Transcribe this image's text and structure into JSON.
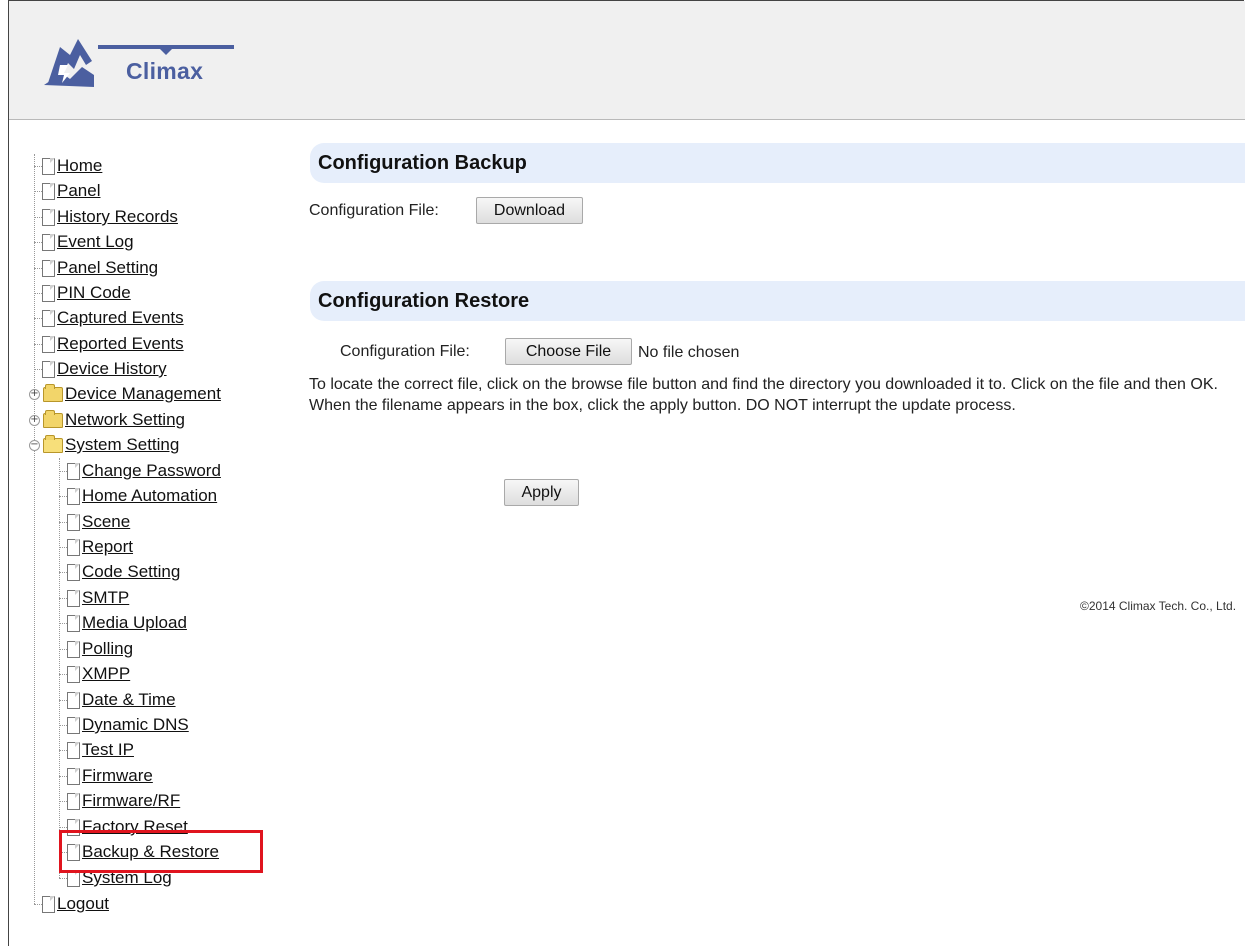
{
  "brand": {
    "name": "Climax"
  },
  "nav": {
    "home": "Home",
    "panel": "Panel",
    "history_records": "History Records",
    "event_log": "Event Log",
    "panel_setting": "Panel Setting",
    "pin_code": "PIN Code",
    "captured_events": "Captured Events",
    "reported_events": "Reported Events",
    "device_history": "Device History",
    "device_management": "Device Management",
    "network_setting": "Network Setting",
    "system_setting": "System Setting",
    "system_children": {
      "change_password": "Change Password",
      "home_automation": "Home Automation",
      "scene": "Scene",
      "report": "Report",
      "code_setting": "Code Setting",
      "smtp": "SMTP",
      "media_upload": "Media Upload",
      "polling": "Polling",
      "xmpp": "XMPP",
      "date_time": "Date & Time",
      "dynamic_dns": "Dynamic DNS",
      "test_ip": "Test IP",
      "firmware": "Firmware",
      "firmware_rf": "Firmware/RF",
      "factory_reset": "Factory Reset",
      "backup_restore": "Backup & Restore",
      "system_log": "System Log"
    },
    "logout": "Logout",
    "expanded_symbol": "−",
    "collapsed_symbol": "+"
  },
  "backup": {
    "title": "Configuration Backup",
    "file_label": "Configuration File:",
    "download_button": "Download"
  },
  "restore": {
    "title": "Configuration Restore",
    "file_label": "Configuration File:",
    "choose_button": "Choose File",
    "no_file": "No file chosen",
    "instructions": "To locate the correct file, click on the browse file button and find the directory you downloaded it to. Click on the file and then OK. When the filename appears in the box, click the apply button. DO NOT interrupt the update process.",
    "apply_button": "Apply"
  },
  "footer": {
    "copyright": "©2014 Climax Tech. Co., Ltd."
  },
  "colors": {
    "header_bg": "#f0f0f0",
    "section_bg": "#e6eefb",
    "highlight": "#e0141e",
    "brand_blue": "#4b5fa0"
  }
}
